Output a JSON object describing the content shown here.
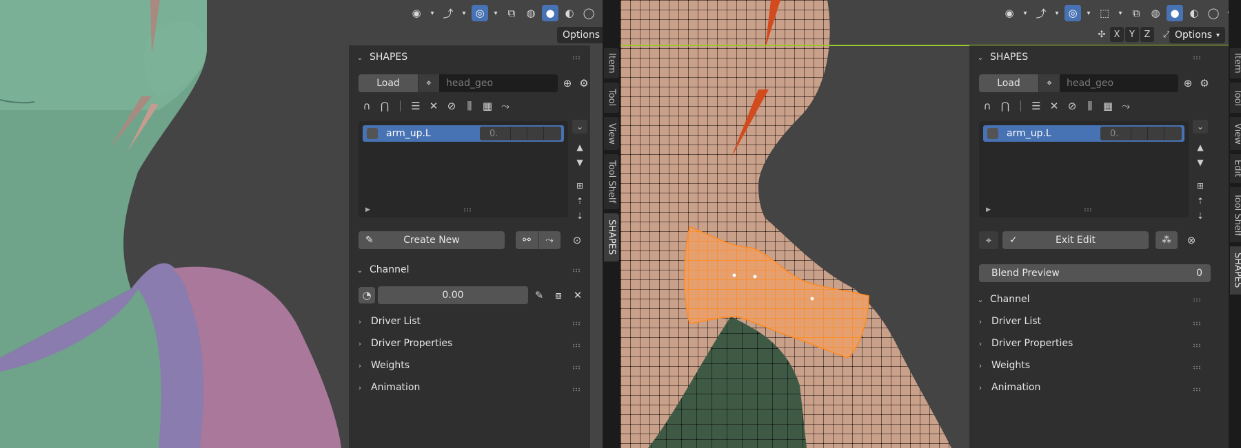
{
  "left": {
    "options_label": "Options",
    "panel_title": "SHAPES",
    "load_label": "Load",
    "geo_placeholder": "head_geo",
    "list_item_name": "arm_up.L",
    "list_item_value": "0.",
    "create_label": "Create New",
    "channel_title": "Channel",
    "channel_value": "0.00",
    "sections": [
      "Driver List",
      "Driver Properties",
      "Weights",
      "Animation"
    ],
    "tabs": [
      "Item",
      "Tool",
      "View",
      "Tool Shelf",
      "SHAPES"
    ]
  },
  "right": {
    "options_label": "Options",
    "axes": [
      "X",
      "Y",
      "Z"
    ],
    "panel_title": "SHAPES",
    "load_label": "Load",
    "geo_placeholder": "head_geo",
    "list_item_name": "arm_up.L",
    "list_item_value": "0.",
    "exit_label": "Exit Edit",
    "blend_label": "Blend Preview",
    "blend_value": "0",
    "channel_title": "Channel",
    "sections": [
      "Driver List",
      "Driver Properties",
      "Weights",
      "Animation"
    ],
    "tabs": [
      "Item",
      "Tool",
      "View",
      "Edit",
      "Tool Shelf",
      "SHAPES"
    ]
  },
  "colors": {
    "accent": "#4772b3",
    "skin_left": "#6fa38a",
    "shirt_left": "#8a7cae",
    "sleeve_left": "#a9789a",
    "skin_right": "#c9a08a",
    "selection": "#ff8a1e",
    "cloth_right": "#3f5a44",
    "active_outline": "#9cc92a"
  }
}
